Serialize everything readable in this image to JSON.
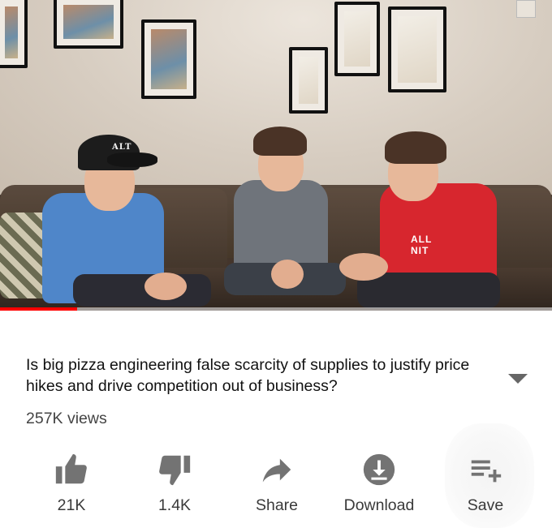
{
  "video": {
    "cap_text": "ALT",
    "shirt_text": "ALL NIT",
    "progress_fraction": 0.14,
    "accent_color": "#ff0000"
  },
  "title": "Is big pizza engineering false scarcity of supplies to justify price hikes and drive competition out of business?",
  "views": "257K views",
  "actions": [
    {
      "id": "like",
      "icon": "thumbs-up-icon",
      "label": "21K"
    },
    {
      "id": "dislike",
      "icon": "thumbs-down-icon",
      "label": "1.4K"
    },
    {
      "id": "share",
      "icon": "share-arrow-icon",
      "label": "Share"
    },
    {
      "id": "download",
      "icon": "download-icon",
      "label": "Download"
    },
    {
      "id": "save",
      "icon": "playlist-add-icon",
      "label": "Save"
    }
  ],
  "expand_icon": "chevron-down-icon"
}
